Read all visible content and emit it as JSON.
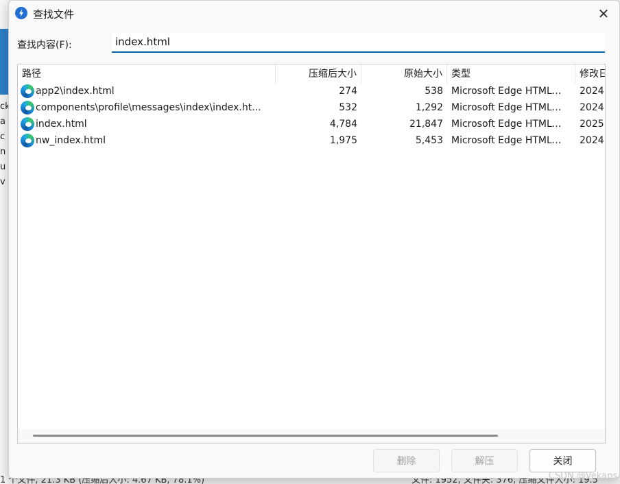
{
  "dialog": {
    "title": "查找文件",
    "search_label": "查找内容(F):",
    "search_value": "index.html"
  },
  "table": {
    "headers": {
      "path": "路径",
      "compressed": "压缩后大小",
      "original": "原始大小",
      "type": "类型",
      "modified": "修改日"
    },
    "rows": [
      {
        "path": "app2\\index.html",
        "compressed": "274",
        "original": "538",
        "type": "Microsoft Edge HTML...",
        "modified": "2024"
      },
      {
        "path": "components\\profile\\messages\\index\\index.ht...",
        "compressed": "532",
        "original": "1,292",
        "type": "Microsoft Edge HTML...",
        "modified": "2024"
      },
      {
        "path": "index.html",
        "compressed": "4,784",
        "original": "21,847",
        "type": "Microsoft Edge HTML...",
        "modified": "2025"
      },
      {
        "path": "nw_index.html",
        "compressed": "1,975",
        "original": "5,453",
        "type": "Microsoft Edge HTML...",
        "modified": "2024"
      }
    ]
  },
  "buttons": {
    "delete": "删除",
    "extract": "解压",
    "close": "关闭"
  },
  "background": {
    "status_left": "1 个文件, 21.3 KB (压缩后大小: 4.67 KB, 78.1%)",
    "status_right": "文件: 1952, 文件夹: 376, 压缩文件大小: 19.5",
    "watermark": "CSDN @Vekaps",
    "side_letters": [
      "ck",
      "a",
      "c",
      "n",
      "u",
      "v"
    ]
  },
  "colors": {
    "accent": "#0063b1",
    "title_icon": "#1f6fd1"
  }
}
